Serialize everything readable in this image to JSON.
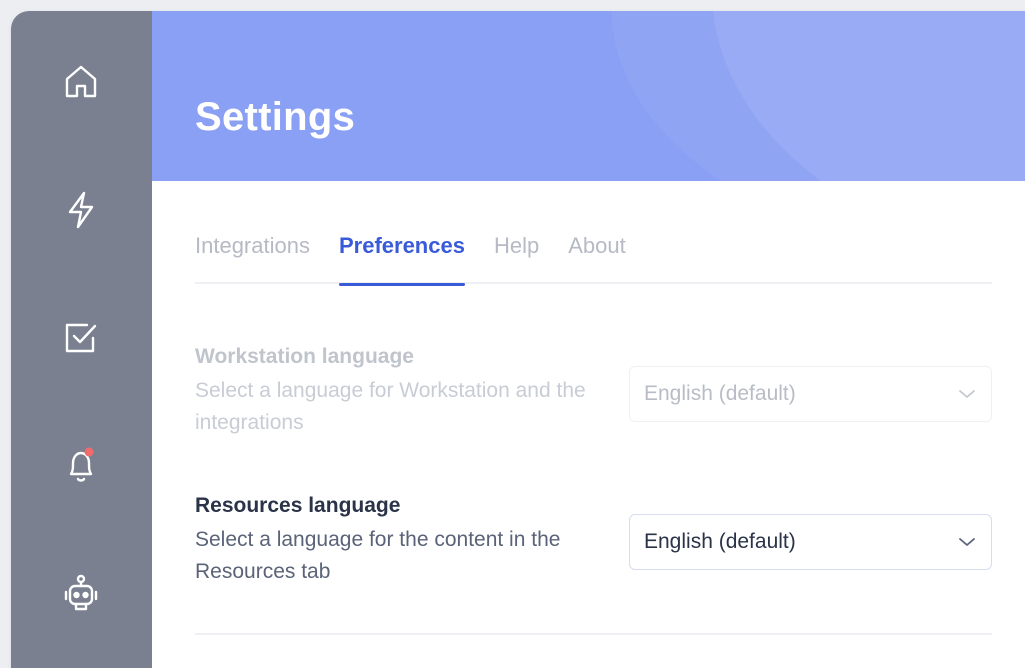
{
  "sidebar": {
    "items": [
      {
        "name": "home",
        "icon": "home-icon"
      },
      {
        "name": "actions",
        "icon": "lightning-icon"
      },
      {
        "name": "tasks",
        "icon": "checkbox-icon"
      },
      {
        "name": "notifications",
        "icon": "bell-icon",
        "badge_color": "#f26b6b"
      },
      {
        "name": "assistant",
        "icon": "bot-icon"
      }
    ]
  },
  "header": {
    "title": "Settings"
  },
  "tabs": [
    {
      "label": "Integrations",
      "active": false
    },
    {
      "label": "Preferences",
      "active": true
    },
    {
      "label": "Help",
      "active": false
    },
    {
      "label": "About",
      "active": false
    }
  ],
  "settings": [
    {
      "label": "Workstation language",
      "description": "Select a language for Workstation and the integrations",
      "value": "English (default)",
      "disabled": true
    },
    {
      "label": "Resources language",
      "description": "Select a language for the content in the Resources tab",
      "value": "English (default)",
      "disabled": false
    }
  ],
  "colors": {
    "accent": "#3a5bd9",
    "header_bg": "#8aa0f5",
    "sidebar_bg": "#7a8090"
  }
}
